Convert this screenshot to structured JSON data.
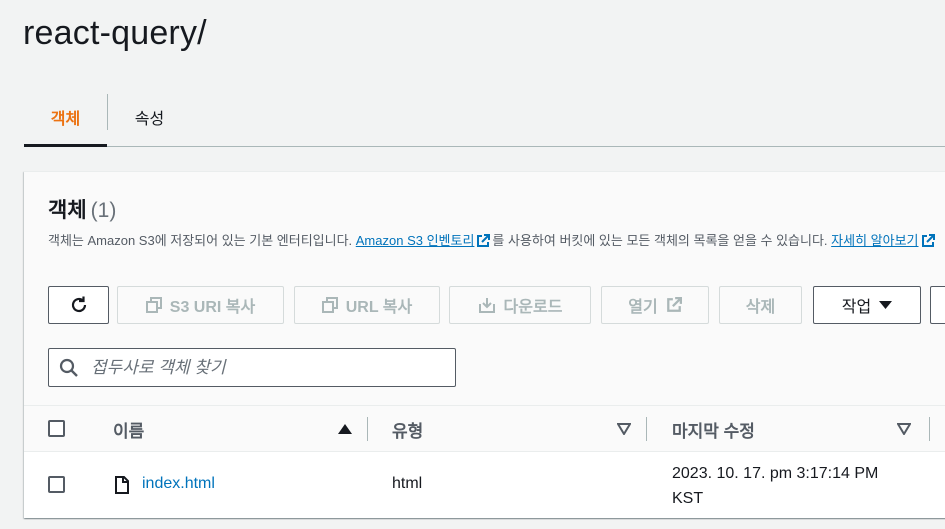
{
  "page": {
    "title": "react-query/"
  },
  "tabs": [
    {
      "label": "객체",
      "active": true
    },
    {
      "label": "속성",
      "active": false
    }
  ],
  "panel": {
    "title": "객체",
    "count": "(1)",
    "description": {
      "part1": "객체는 Amazon S3에 저장되어 있는 기본 엔터티입니다. ",
      "link1": "Amazon S3 인벤토리",
      "part2": "를 사용하여 버킷에 있는 모든 객체의 목록을 얻을 수 있습니다. ",
      "link2": "자세히 알아보기"
    }
  },
  "toolbar": {
    "refresh_icon": "refresh-icon",
    "copy_s3_uri": "S3 URI 복사",
    "copy_url": "URL 복사",
    "download": "다운로드",
    "open": "열기",
    "delete": "삭제",
    "actions": "작업"
  },
  "search": {
    "placeholder": "접두사로 객체 찾기",
    "value": ""
  },
  "table": {
    "columns": [
      {
        "label": "이름",
        "sort": "ascending"
      },
      {
        "label": "유형",
        "sort": "none"
      },
      {
        "label": "마지막 수정",
        "sort": "none"
      }
    ],
    "rows": [
      {
        "name": "index.html",
        "type": "html",
        "modified_line1": "2023. 10. 17. pm 3:17:14 PM",
        "modified_line2": "KST"
      }
    ]
  },
  "colors": {
    "accent": "#ec7211",
    "link": "#0073bb",
    "text": "#16191f",
    "muted": "#545b64",
    "disabled": "#aab7b8",
    "background": "#f2f3f3"
  }
}
